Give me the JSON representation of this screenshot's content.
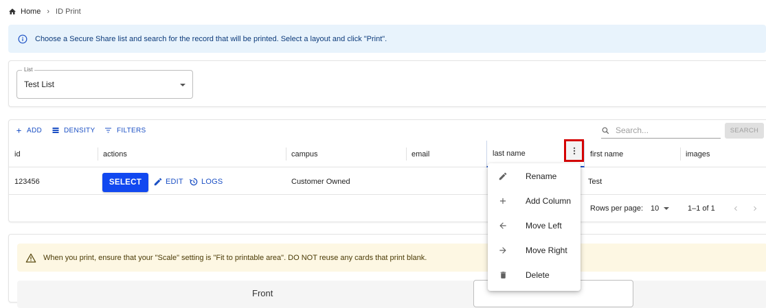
{
  "breadcrumb": {
    "home": "Home",
    "separator": "›",
    "current": "ID Print"
  },
  "info_banner": {
    "text": "Choose a Secure Share list and search for the record that will be printed. Select a layout and click \"Print\"."
  },
  "list_select": {
    "label": "List",
    "value": "Test List"
  },
  "toolbar": {
    "add": "ADD",
    "density": "DENSITY",
    "filters": "FILTERS",
    "search_placeholder": "Search...",
    "search_button": "SEARCH"
  },
  "columns": [
    {
      "label": "id"
    },
    {
      "label": "actions"
    },
    {
      "label": "campus"
    },
    {
      "label": "email"
    },
    {
      "label": "last name"
    },
    {
      "label": "first name"
    },
    {
      "label": "images"
    }
  ],
  "rows": [
    {
      "id": "123456",
      "select": "SELECT",
      "edit": "EDIT",
      "logs": "LOGS",
      "campus": "Customer Owned",
      "email": "",
      "first_name": "Test"
    }
  ],
  "pagination": {
    "rows_per_page_label": "Rows per page:",
    "rows_per_page": "10",
    "range": "1–1 of 1"
  },
  "column_menu": {
    "items": [
      {
        "label": "Rename",
        "icon": "pencil-icon"
      },
      {
        "label": "Add Column",
        "icon": "plus-icon"
      },
      {
        "label": "Move Left",
        "icon": "arrow-left-icon"
      },
      {
        "label": "Move Right",
        "icon": "arrow-right-icon"
      },
      {
        "label": "Delete",
        "icon": "trash-icon"
      }
    ]
  },
  "warning_banner": {
    "text": "When you print, ensure that your \"Scale\" setting is \"Fit to printable area\". DO NOT reuse any cards that print blank."
  },
  "layout_section": {
    "label": "Front"
  },
  "colors": {
    "accent": "#1a4fc4",
    "select_button": "#1148f0",
    "highlight": "#d40000",
    "info_bg": "#e8f3fc",
    "warn_bg": "#fdf7e3"
  }
}
